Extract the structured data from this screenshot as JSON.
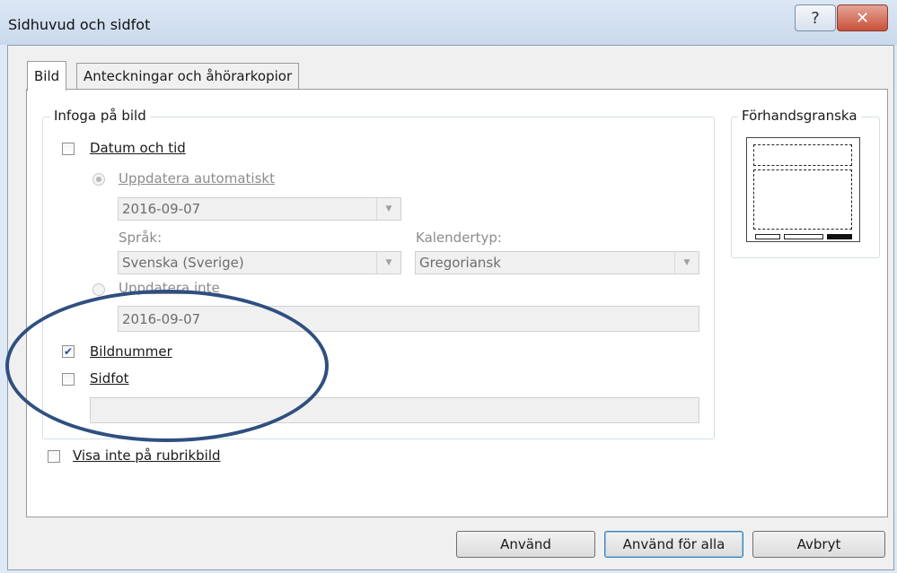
{
  "window": {
    "title": "Sidhuvud och sidfot",
    "help_glyph": "?",
    "close_glyph": "✕"
  },
  "tabs": [
    {
      "label": "Bild",
      "active": true
    },
    {
      "label": "Anteckningar och åhörarkopior",
      "active": false
    }
  ],
  "insert_group": {
    "legend": "Infoga på bild",
    "date_time": {
      "label": "Datum och tid",
      "checked": false
    },
    "update_auto": {
      "label": "Uppdatera automatiskt",
      "selected": true,
      "enabled": false
    },
    "date_value": "2016-09-07",
    "language_label": "Språk:",
    "language_value": "Svenska (Sverige)",
    "calendar_label": "Kalendertyp:",
    "calendar_value": "Gregoriansk",
    "fixed": {
      "label": "Uppdatera inte",
      "selected": false,
      "enabled": false
    },
    "fixed_value": "2016-09-07",
    "slide_number": {
      "label": "Bildnummer",
      "checked": true
    },
    "footer": {
      "label": "Sidfot",
      "checked": false
    },
    "footer_value": ""
  },
  "dont_show_title": {
    "label": "Visa inte på rubrikbild",
    "checked": false
  },
  "preview": {
    "legend": "Förhandsgranska"
  },
  "buttons": {
    "apply": "Använd",
    "apply_all": "Använd för alla",
    "cancel": "Avbryt"
  },
  "annotation": {
    "color": "#2f4f80"
  }
}
